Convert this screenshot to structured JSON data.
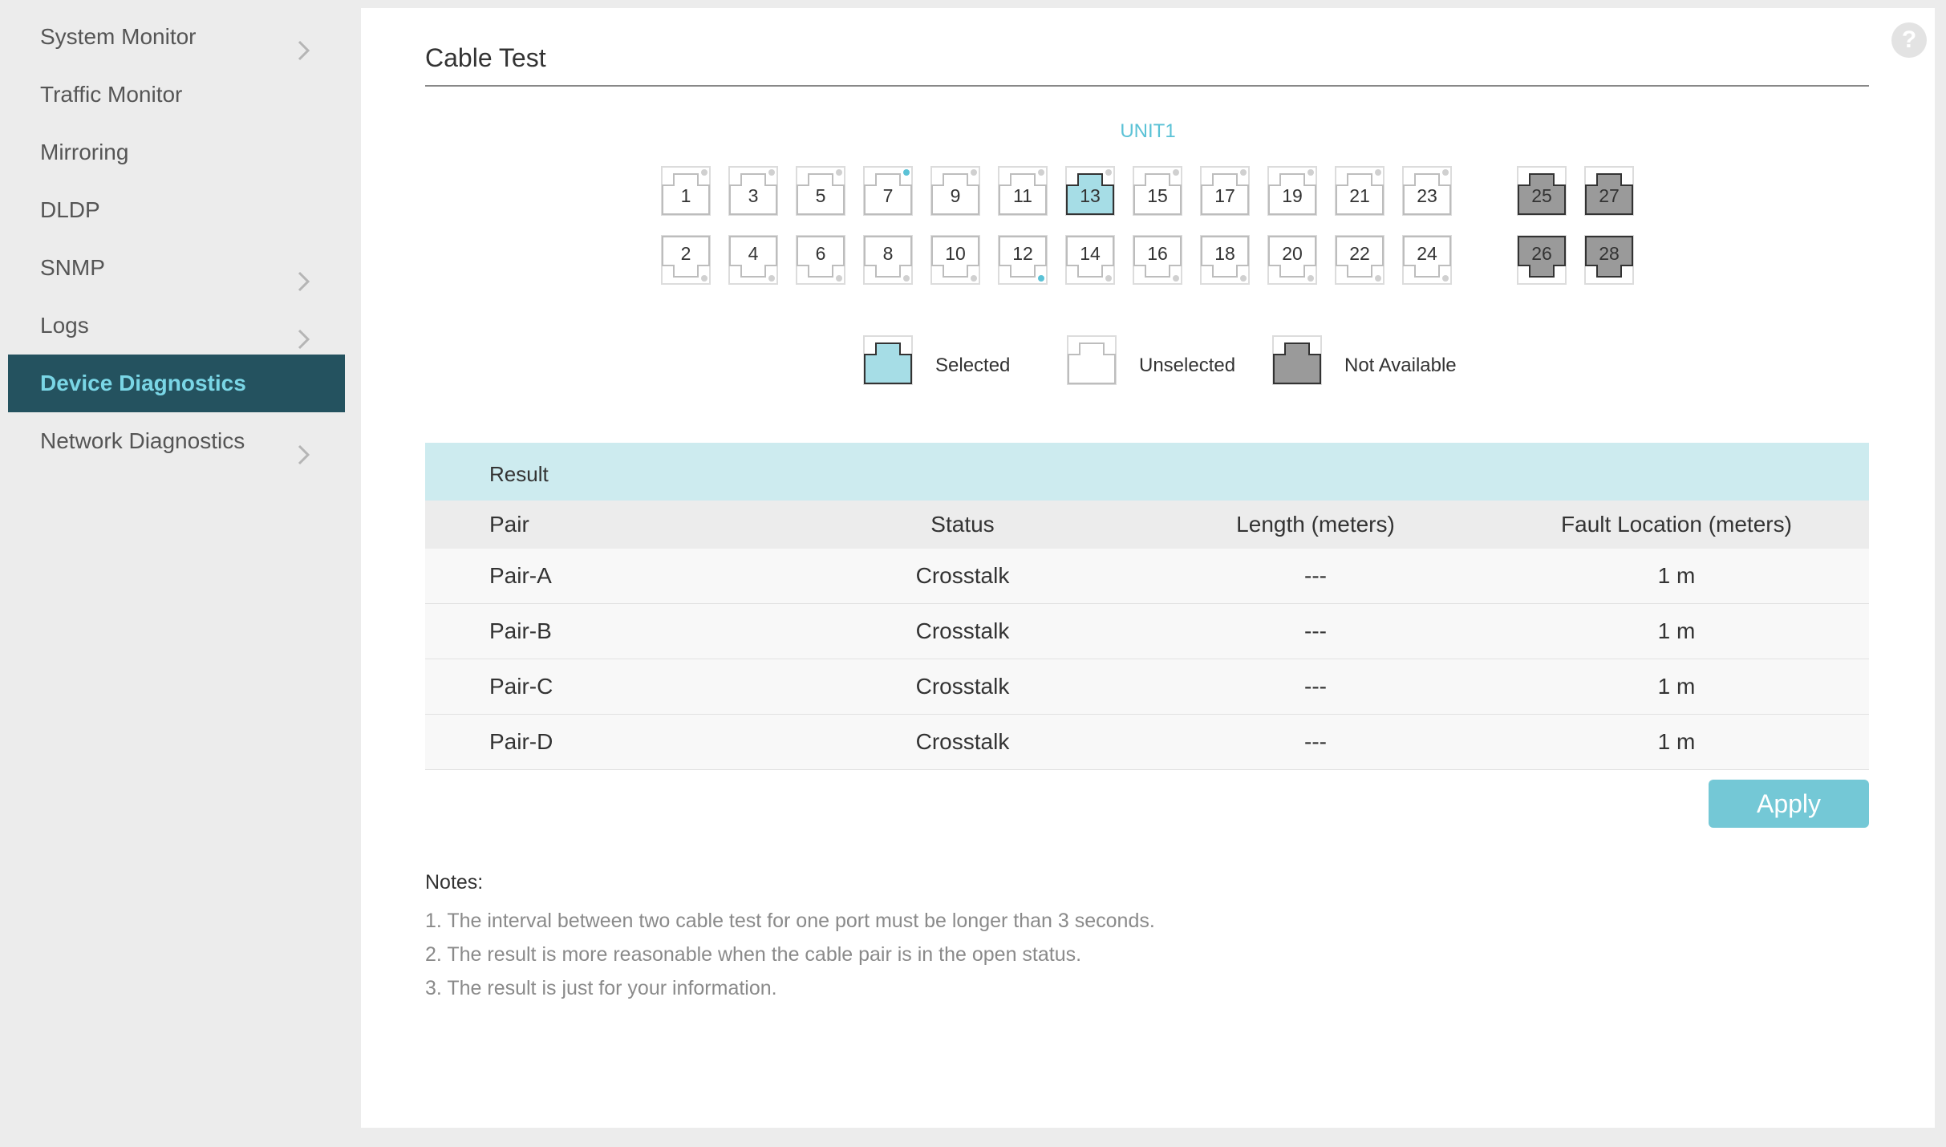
{
  "sidebar": {
    "items": [
      {
        "label": "System Monitor",
        "chevron": true,
        "active": false
      },
      {
        "label": "Traffic Monitor",
        "chevron": false,
        "active": false
      },
      {
        "label": "Mirroring",
        "chevron": false,
        "active": false
      },
      {
        "label": "DLDP",
        "chevron": false,
        "active": false
      },
      {
        "label": "SNMP",
        "chevron": true,
        "active": false
      },
      {
        "label": "Logs",
        "chevron": true,
        "active": false
      },
      {
        "label": "Device Diagnostics",
        "chevron": false,
        "active": true
      },
      {
        "label": "Network Diagnostics",
        "chevron": true,
        "active": false
      }
    ]
  },
  "help": {
    "icon": "question-icon",
    "glyph": "?"
  },
  "page": {
    "title": "Cable Test"
  },
  "unit": {
    "label": "UNIT1"
  },
  "ports": {
    "top": [
      "1",
      "3",
      "5",
      "7",
      "9",
      "11",
      "13",
      "15",
      "17",
      "19",
      "21",
      "23"
    ],
    "bottom": [
      "2",
      "4",
      "6",
      "8",
      "10",
      "12",
      "14",
      "16",
      "18",
      "20",
      "22",
      "24"
    ],
    "sfp_top": [
      "25",
      "27"
    ],
    "sfp_bottom": [
      "26",
      "28"
    ],
    "selected": [
      "13"
    ],
    "link_up": [
      "7",
      "12"
    ],
    "not_available": [
      "25",
      "26",
      "27",
      "28"
    ]
  },
  "legend": {
    "selected": "Selected",
    "unselected": "Unselected",
    "not_available": "Not Available"
  },
  "result": {
    "title": "Result",
    "columns": [
      "Pair",
      "Status",
      "Length (meters)",
      "Fault Location (meters)"
    ],
    "rows": [
      [
        "Pair-A",
        "Crosstalk",
        "---",
        "1 m"
      ],
      [
        "Pair-B",
        "Crosstalk",
        "---",
        "1 m"
      ],
      [
        "Pair-C",
        "Crosstalk",
        "---",
        "1 m"
      ],
      [
        "Pair-D",
        "Crosstalk",
        "---",
        "1 m"
      ]
    ]
  },
  "apply_label": "Apply",
  "notes": {
    "title": "Notes:",
    "items": [
      "1. The interval between two cable test for one port must be longer than 3 seconds.",
      "2. The result is more reasonable when the cable pair is in the open status.",
      "3. The result is just for your information."
    ]
  },
  "colors": {
    "accent": "#5bc2d6",
    "sidebar_active_bg": "#24525f",
    "selected_port": "#a6dde6",
    "not_available_port": "#9a9a9a",
    "link_dot": "#5bc2d6",
    "result_header_bg": "#cdebef",
    "apply_bg": "#74c8d6"
  }
}
